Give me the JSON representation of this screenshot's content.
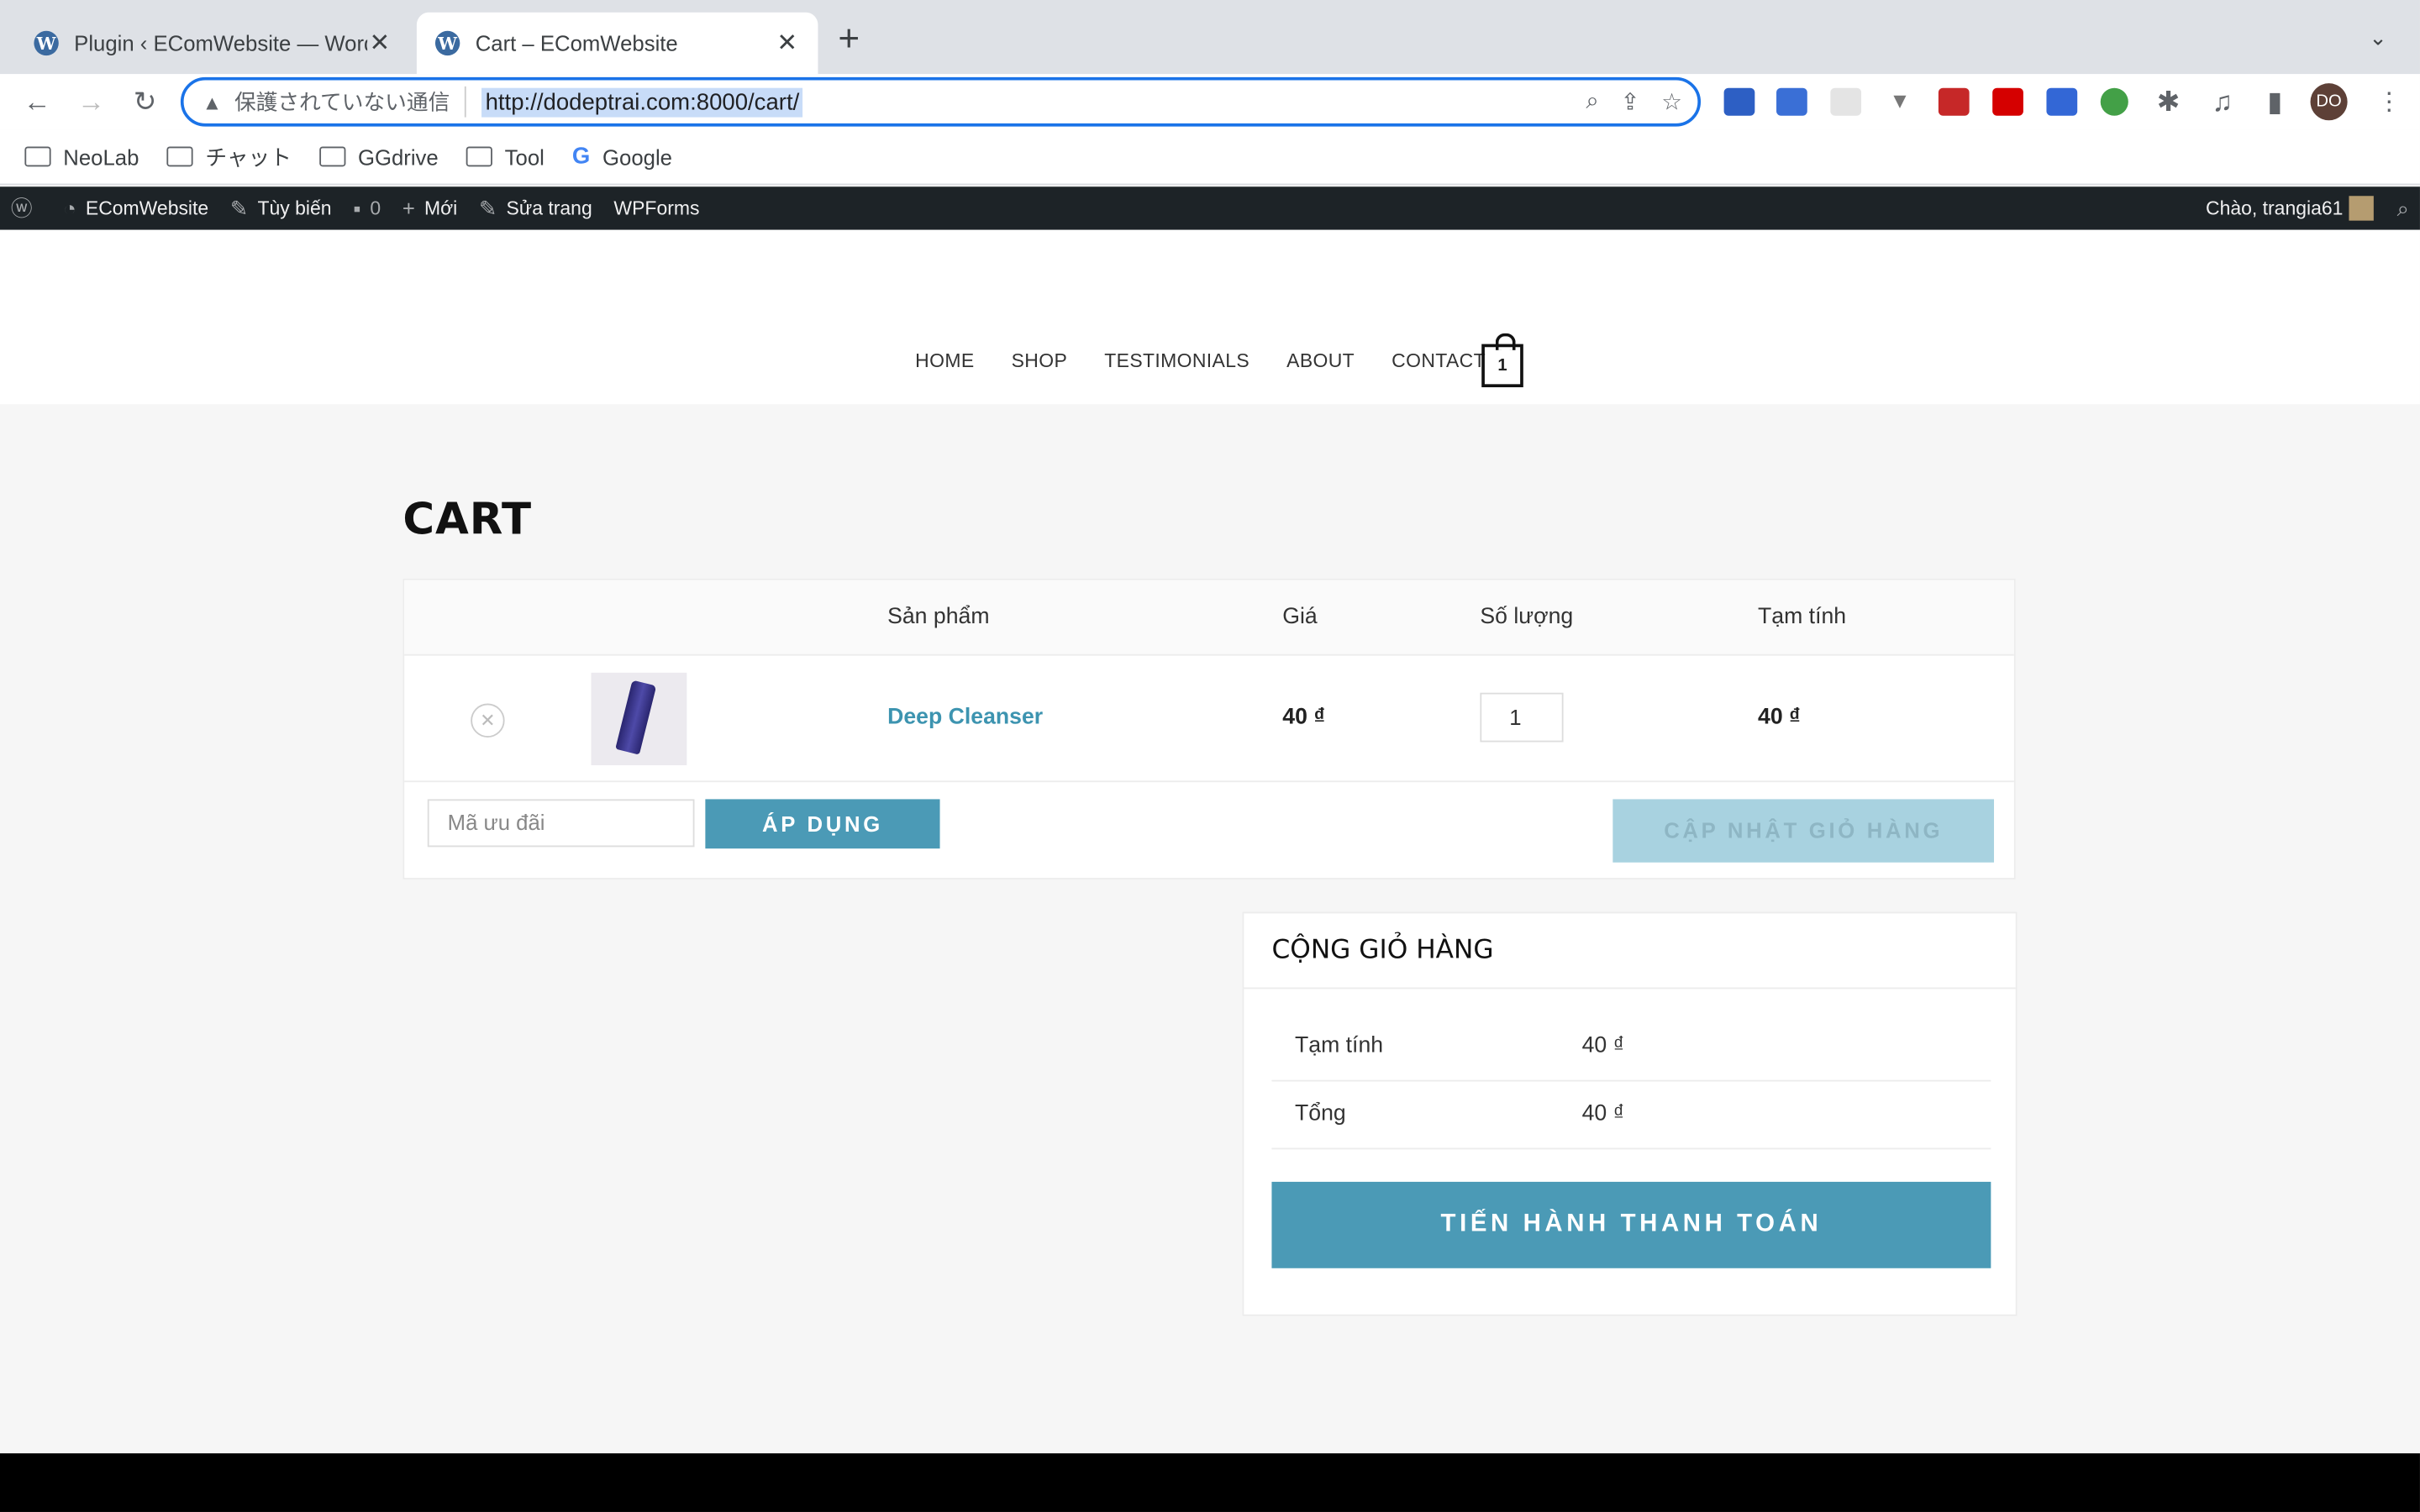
{
  "browser": {
    "tabs": [
      {
        "title": "Plugin ‹ EComWebsite — WordPress",
        "active": false
      },
      {
        "title": "Cart – EComWebsite",
        "active": true
      }
    ],
    "security_label": "保護されていない通信",
    "url": "http://dodeptrai.com:8000/cart/",
    "profile_initials": "DO",
    "bookmarks": [
      "NeoLab",
      "チャット",
      "GGdrive",
      "Tool",
      "Google"
    ]
  },
  "adminbar": {
    "site_name": "EComWebsite",
    "customize": "Tùy biến",
    "comments_count": "0",
    "new": "Mới",
    "edit_page": "Sửa trang",
    "wpforms": "WPForms",
    "greeting": "Chào, trangia61"
  },
  "nav": {
    "items": [
      "HOME",
      "SHOP",
      "TESTIMONIALS",
      "ABOUT",
      "CONTACT"
    ],
    "cart_count": "1"
  },
  "page": {
    "title": "CART"
  },
  "cart": {
    "headers": {
      "product": "Sản phẩm",
      "price": "Giá",
      "quantity": "Số lượng",
      "subtotal": "Tạm tính"
    },
    "items": [
      {
        "name": "Deep Cleanser",
        "price": "40 ₫",
        "quantity": "1",
        "subtotal": "40 ₫"
      }
    ],
    "coupon_placeholder": "Mã ưu đãi",
    "apply_label": "ÁP DỤNG",
    "update_label": "CẬP NHẬT GIỎ HÀNG"
  },
  "totals": {
    "title": "CỘNG GIỎ HÀNG",
    "subtotal_label": "Tạm tính",
    "subtotal_value": "40 ₫",
    "total_label": "Tổng",
    "total_value": "40 ₫",
    "checkout_label": "TIẾN HÀNH THANH TOÁN"
  },
  "colors": {
    "accent": "#4b9ab6",
    "link": "#3d94b0",
    "adminbar": "#1d2327"
  }
}
